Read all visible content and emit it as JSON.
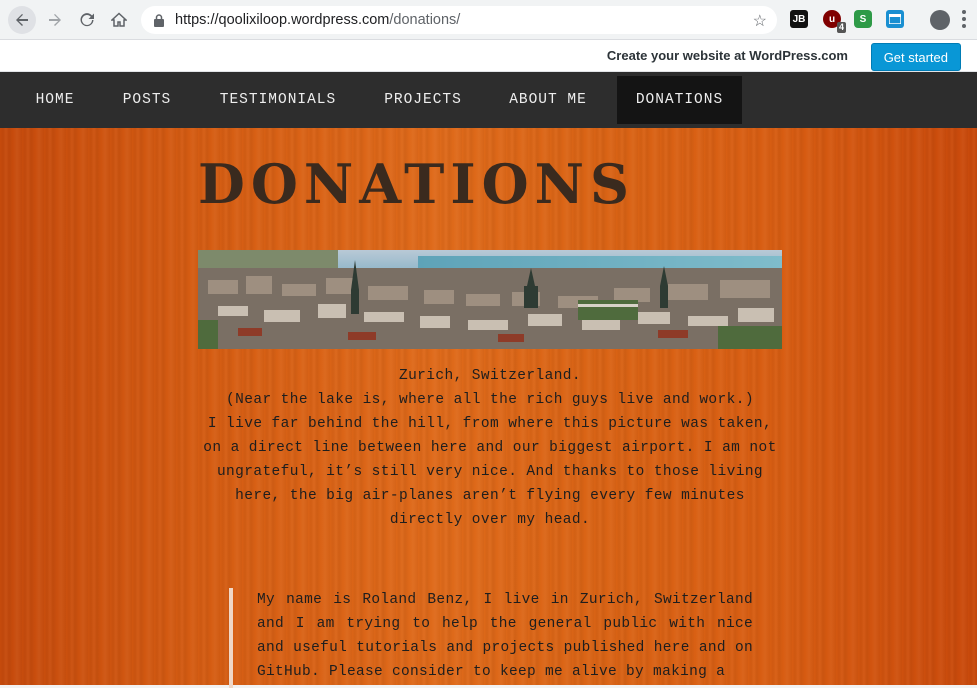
{
  "browser": {
    "url_host": "https://qoolixiloop.wordpress.com",
    "url_path": "/donations/",
    "extensions": {
      "jb_label": "JB",
      "ublock_badge": "4",
      "s_label": "S"
    }
  },
  "wp_bar": {
    "cta_text": "Create your website at WordPress.com",
    "get_started_label": "Get started",
    "button_color": "#0997d6"
  },
  "nav": {
    "items": [
      {
        "label": "HOME"
      },
      {
        "label": "POSTS"
      },
      {
        "label": "TESTIMONIALS"
      },
      {
        "label": "PROJECTS"
      },
      {
        "label": "ABOUT ME"
      },
      {
        "label": "DONATIONS"
      }
    ],
    "active_index": 5
  },
  "page": {
    "title": "DONATIONS",
    "banner_caption_city": "Zurich, Switzerland.",
    "banner_caption_lake": "(Near the lake is, where all the rich guys live and work.)",
    "description": "I live far behind the hill, from where this picture was taken, on a direct line between here and our biggest airport. I am not ungrateful, it’s still very nice. And thanks to those living here, the big air-planes aren’t flying every few minutes directly over my head.",
    "quote": "My name is Roland Benz, I live in Zurich, Switzerland and I am trying to help the general public with nice and useful tutorials and projects published here and on GitHub. Please consider to keep me alive by making a"
  },
  "colors": {
    "nav_bg": "#2d2d2d",
    "content_bg": "#d55c12",
    "title_color": "#3a2a1e"
  }
}
